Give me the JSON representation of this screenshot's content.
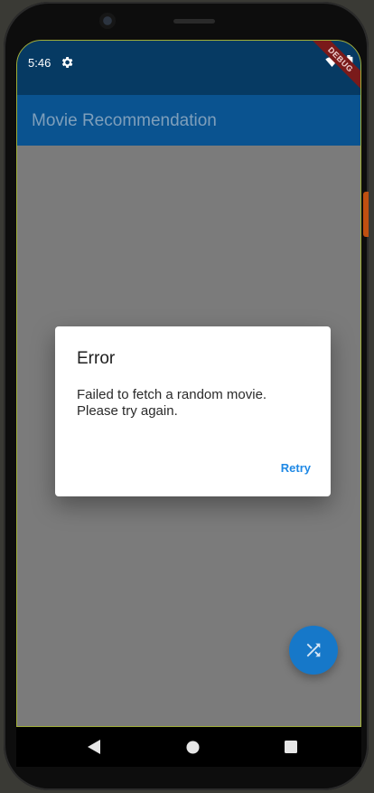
{
  "status_bar": {
    "time": "5:46",
    "debug_banner": "DEBUG"
  },
  "app_bar": {
    "title": "Movie Recommendation"
  },
  "dialog": {
    "title": "Error",
    "message": "Failed to fetch a random movie.\nPlease try again.",
    "retry_label": "Retry"
  },
  "fab": {
    "icon": "shuffle-icon"
  },
  "navigation_bar": {
    "back_icon": "back-triangle-icon",
    "home_icon": "home-circle-icon",
    "recents_icon": "recents-square-icon"
  },
  "colors": {
    "status_bar": "#063a63",
    "app_bar": "#0a5390",
    "scrim_background": "#7b7b7b",
    "accent": "#1e88e5",
    "fab": "#1678c9"
  }
}
